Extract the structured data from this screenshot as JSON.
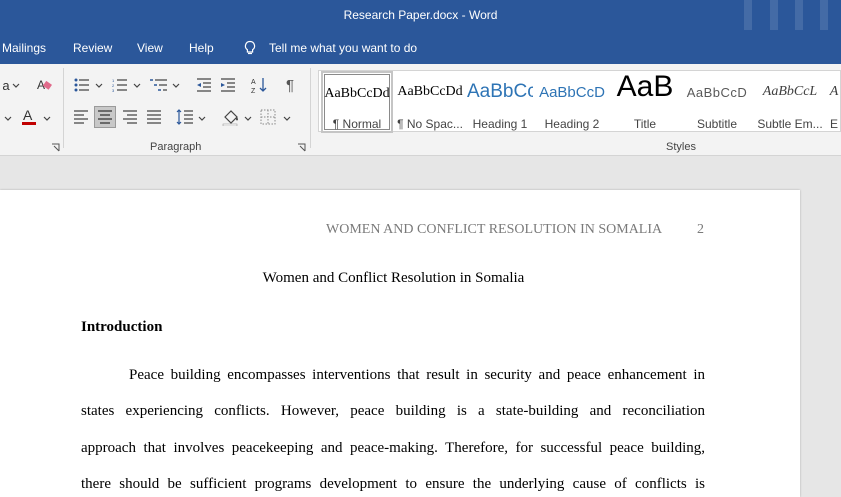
{
  "window": {
    "title": "Research Paper.docx  -  Word"
  },
  "menu": {
    "items": [
      "Mailings",
      "Review",
      "View",
      "Help"
    ],
    "tell_me": "Tell me what you want to do"
  },
  "ribbon": {
    "groups": {
      "paragraph": "Paragraph",
      "styles": "Styles"
    },
    "style_gallery": [
      {
        "sample": "AaBbCcDd",
        "name": "¶ Normal",
        "selected": true
      },
      {
        "sample": "AaBbCcDd",
        "name": "¶ No Spac..."
      },
      {
        "sample": "AaBbCc",
        "name": "Heading 1"
      },
      {
        "sample": "AaBbCcD",
        "name": "Heading 2"
      },
      {
        "sample": "AaB",
        "name": "Title"
      },
      {
        "sample": "AaBbCcD",
        "name": "Subtitle"
      },
      {
        "sample": "AaBbCcL",
        "name": "Subtle Em..."
      },
      {
        "sample": "A",
        "name": "E"
      }
    ],
    "colors": {
      "font_color": "#c00000",
      "accent": "#2b579a"
    }
  },
  "document": {
    "header": "WOMEN AND CONFLICT RESOLUTION IN SOMALIA",
    "page_number": "2",
    "title": "Women and Conflict Resolution in Somalia",
    "heading": "Introduction",
    "lines": [
      "Peace building encompasses interventions that result in security and peace enhancement in",
      "states experiencing conflicts. However, peace building is a state-building and reconciliation",
      "approach that involves peacekeeping and peace-making. Therefore, for successful peace building,",
      "there should be sufficient programs development to ensure the underlying cause of conflicts is"
    ]
  }
}
